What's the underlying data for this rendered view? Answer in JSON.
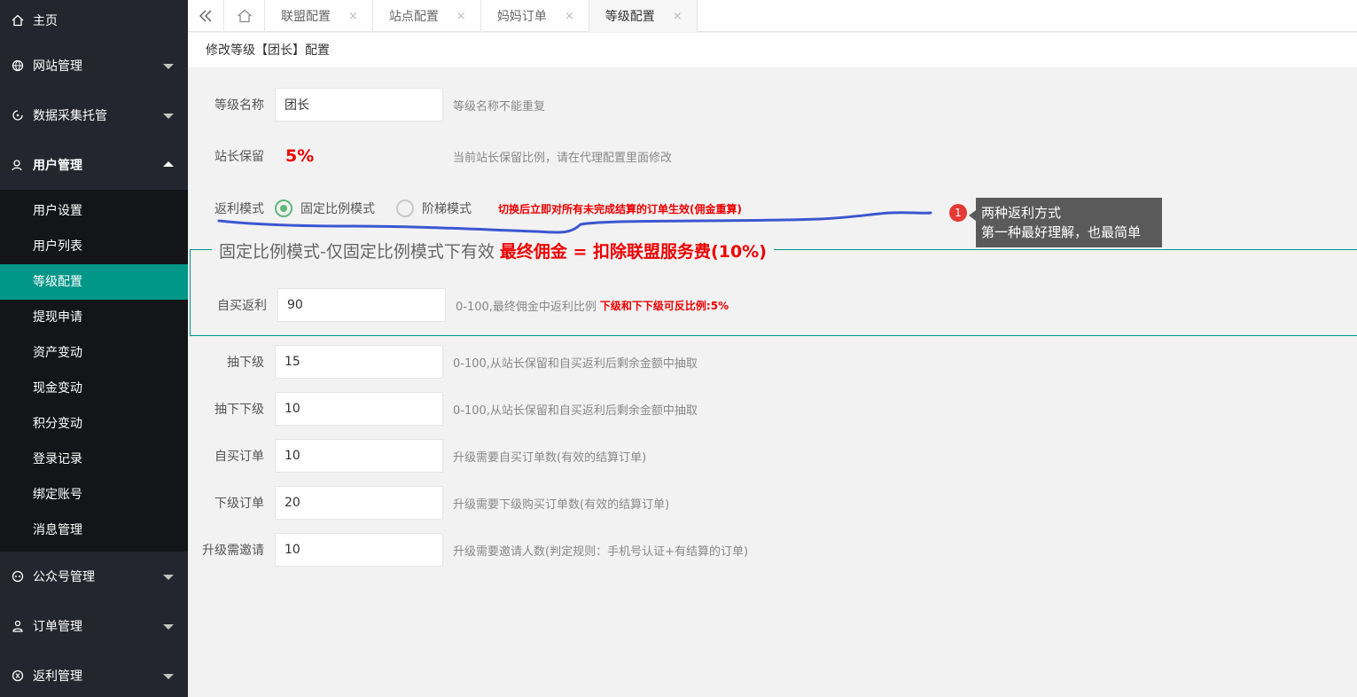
{
  "sidebar": {
    "home": "主页",
    "menus": [
      {
        "label": "网站管理",
        "icon": "globe-icon"
      },
      {
        "label": "数据采集托管",
        "icon": "sync-icon"
      },
      {
        "label": "用户管理",
        "icon": "user-icon"
      }
    ],
    "user_sub": [
      "用户设置",
      "用户列表",
      "等级配置",
      "提现申请",
      "资产变动",
      "现金变动",
      "积分变动",
      "登录记录",
      "绑定账号",
      "消息管理"
    ],
    "active_sub": "等级配置",
    "bottom_menus": [
      {
        "label": "公众号管理",
        "icon": "wechat-icon"
      },
      {
        "label": "订单管理",
        "icon": "order-icon"
      },
      {
        "label": "返利管理",
        "icon": "rebate-icon"
      }
    ]
  },
  "tabs": [
    {
      "label": "联盟配置",
      "close": "×"
    },
    {
      "label": "站点配置",
      "close": "×"
    },
    {
      "label": "妈妈订单",
      "close": "×"
    },
    {
      "label": "等级配置",
      "close": "×"
    }
  ],
  "breadcrumb": "修改等级【团长】配置",
  "form": {
    "level_name": {
      "label": "等级名称",
      "value": "团长",
      "hint": "等级名称不能重复"
    },
    "owner_keep": {
      "label": "站长保留",
      "value": "5%",
      "hint": "当前站长保留比例，请在代理配置里面修改"
    },
    "rebate_mode": {
      "label": "返利模式",
      "options": [
        "固定比例模式",
        "阶梯模式"
      ],
      "selected": "固定比例模式",
      "note": "切换后立即对所有未完成结算的订单生效(佣金重算)"
    },
    "fieldset": {
      "legend_a": "固定比例模式-仅固定比例模式下有效",
      "legend_b": "最终佣金 = 扣除联盟服务费(10%)"
    },
    "self_rebate": {
      "label": "自买返利",
      "value": "90",
      "hint": "0-100,最终佣金中返利比例",
      "hint_red": "下级和下下级可反比例:5%"
    },
    "take_sub": {
      "label": "抽下级",
      "value": "15",
      "hint": "0-100,从站长保留和自买返利后剩余金额中抽取"
    },
    "take_subsub": {
      "label": "抽下下级",
      "value": "10",
      "hint": "0-100,从站长保留和自买返利后剩余金额中抽取"
    },
    "self_orders": {
      "label": "自买订单",
      "value": "10",
      "hint": "升级需要自买订单数(有效的结算订单)"
    },
    "sub_orders": {
      "label": "下级订单",
      "value": "20",
      "hint": "升级需要下级购买订单数(有效的结算订单)"
    },
    "invites": {
      "label": "升级需邀请",
      "value": "10",
      "hint": "升级需要邀请人数(判定规则：手机号认证+有结算的订单)"
    }
  },
  "annotation": {
    "badge": "1",
    "line1": "两种返利方式",
    "line2": "第一种最好理解，也最简单"
  },
  "colors": {
    "sidebar": "#23262e",
    "active": "#009688",
    "accent_red": "#e00000",
    "radio_green": "#5fb878",
    "scribble": "#3b56d0"
  }
}
